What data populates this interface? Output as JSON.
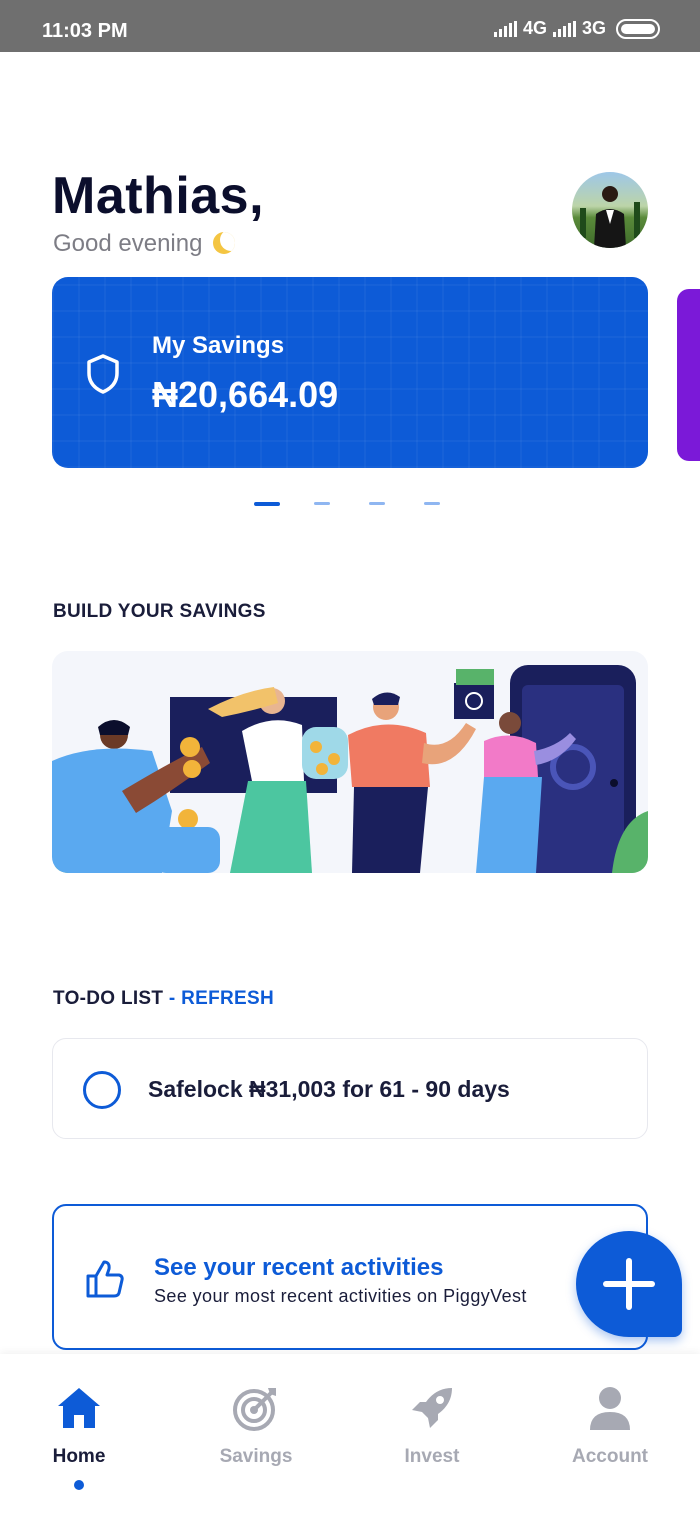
{
  "status_bar": {
    "time": "11:03 PM",
    "network_1": "4G",
    "network_2": "3G"
  },
  "header": {
    "name": "Mathias,",
    "greeting": "Good evening"
  },
  "savings_card": {
    "label": "My Savings",
    "amount": "₦20,664.09",
    "color": "#0d5bd7"
  },
  "carousel": {
    "count": 4,
    "active_index": 0
  },
  "build_section": {
    "title": "BUILD YOUR SAVINGS"
  },
  "todo": {
    "title": "TO-DO LIST",
    "separator": " - ",
    "refresh": "REFRESH",
    "items": [
      {
        "text": "Safelock ₦31,003 for 61 - 90 days"
      }
    ]
  },
  "activity": {
    "title": "See your recent activities",
    "subtitle": "See your most recent activities on PiggyVest"
  },
  "bottom_nav": {
    "items": [
      {
        "label": "Home",
        "icon": "home-icon",
        "active": true
      },
      {
        "label": "Savings",
        "icon": "target-icon",
        "active": false
      },
      {
        "label": "Invest",
        "icon": "rocket-icon",
        "active": false
      },
      {
        "label": "Account",
        "icon": "user-icon",
        "active": false
      }
    ]
  },
  "colors": {
    "brand_blue": "#0d5bd7",
    "purple_card": "#7b19d8",
    "inactive_nav": "#a7a9b3"
  }
}
